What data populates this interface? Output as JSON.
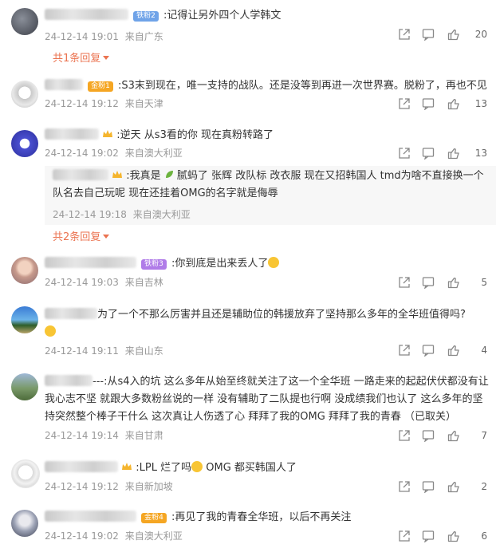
{
  "comments": [
    {
      "id": "c1",
      "text": ":记得让另外四个人学韩文",
      "badge": "铁粉2",
      "time": "24-12-14 19:01",
      "location": "来自广东",
      "likes": "20",
      "replies": "共1条回复"
    },
    {
      "id": "c2",
      "text": ":S3末到现在，唯一支持的战队。还是没等到再进一次世界赛。脱粉了，再也不见",
      "badge": "金粉1",
      "time": "24-12-14 19:12",
      "location": "来自天津",
      "likes": "13"
    },
    {
      "id": "c3",
      "text": ":逆天 从s3看的你 现在真粉转路了",
      "time": "24-12-14 19:02",
      "location": "来自澳大利亚",
      "likes": "13",
      "replies": "共2条回复",
      "reply": {
        "text": ":我真是 ",
        "text2": " 腻蚂了 张辉 改队标 改衣服 现在又招韩国人 tmd为啥不直接换一个队名去自己玩呢  现在还挂着OMG的名字就是侮辱",
        "time": "24-12-14 19:18",
        "location": "来自澳大利亚"
      }
    },
    {
      "id": "c4",
      "text": ":你到底是出来丢人了",
      "badge": "铁粉3",
      "time": "24-12-14 19:03",
      "location": "来自吉林",
      "likes": "5"
    },
    {
      "id": "c5",
      "text": "为了一个不那么厉害并且还是辅助位的韩援放弃了坚持那么多年的全华班值得吗?",
      "time": "24-12-14 19:11",
      "location": "来自山东",
      "likes": "4"
    },
    {
      "id": "c6",
      "text": "---:从s4入的坑 这么多年从始至终就关注了这一个全华班 一路走来的起起伏伏都没有让我心志不坚 就跟大多数粉丝说的一样 没有辅助了二队提也行啊 没成绩我们也认了 这么多年的坚持突然整个棒子干什么 这次真让人伤透了心 拜拜了我的OMG 拜拜了我的青春 （已取关）",
      "time": "24-12-14 19:14",
      "location": "来自甘肃",
      "likes": "7"
    },
    {
      "id": "c7",
      "text": ":LPL 烂了吗",
      "text2": " OMG 都买韩国人了",
      "time": "24-12-14 19:12",
      "location": "来自新加坡",
      "likes": "2"
    },
    {
      "id": "c8",
      "text": ":再见了我的青春全华班，以后不再关注",
      "badge": "金粉4",
      "time": "24-12-14 19:02",
      "location": "来自澳大利亚",
      "likes": "6"
    }
  ],
  "colors": {
    "accent": "#eb7350",
    "meta": "#999999",
    "text": "#333333",
    "badge_iron": "#6fa3e8",
    "badge_gold": "#f5a623",
    "badge_purple": "#b07ce8"
  },
  "icons": [
    "share-icon",
    "comment-icon",
    "like-icon",
    "crown-icon"
  ]
}
